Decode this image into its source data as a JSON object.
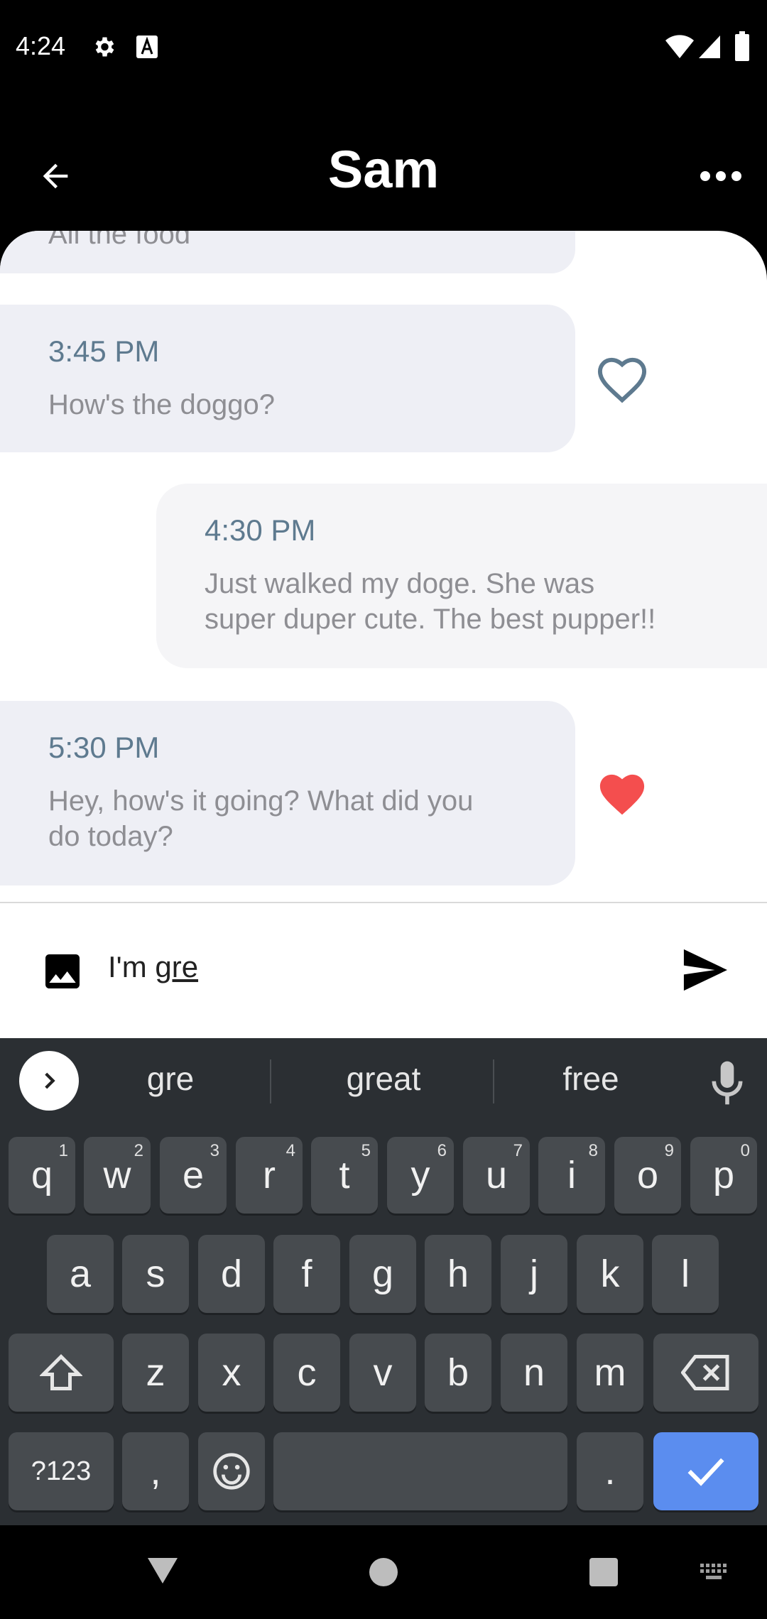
{
  "status_bar": {
    "time": "4:24"
  },
  "header": {
    "title": "Sam"
  },
  "messages": [
    {
      "sender": "them",
      "time": "",
      "text": "All the food",
      "liked": false
    },
    {
      "sender": "them",
      "time": "3:45 PM",
      "text": "How's the doggo?",
      "liked": false
    },
    {
      "sender": "me",
      "time": "4:30 PM",
      "text_lines": [
        "Just walked my doge. She was",
        "super duper cute. The best pupper!!"
      ]
    },
    {
      "sender": "them",
      "time": "5:30 PM",
      "text_lines": [
        "Hey, how's it going? What did you",
        "do today?"
      ],
      "liked": true
    }
  ],
  "composer": {
    "prefix": "I'm ",
    "typed_word": "gre"
  },
  "keyboard": {
    "suggestions": [
      "gre",
      "great",
      "free"
    ],
    "row1": [
      "q",
      "w",
      "e",
      "r",
      "t",
      "y",
      "u",
      "i",
      "o",
      "p"
    ],
    "row1_hints": [
      "1",
      "2",
      "3",
      "4",
      "5",
      "6",
      "7",
      "8",
      "9",
      "0"
    ],
    "row2": [
      "a",
      "s",
      "d",
      "f",
      "g",
      "h",
      "j",
      "k",
      "l"
    ],
    "row3": [
      "z",
      "x",
      "c",
      "v",
      "b",
      "n",
      "m"
    ],
    "symbols_label": "?123",
    "comma": ",",
    "period": "."
  },
  "colors": {
    "accent": "#5B8DEF",
    "heart_red": "#F44E4E",
    "heart_outline": "#5E7A8F"
  }
}
